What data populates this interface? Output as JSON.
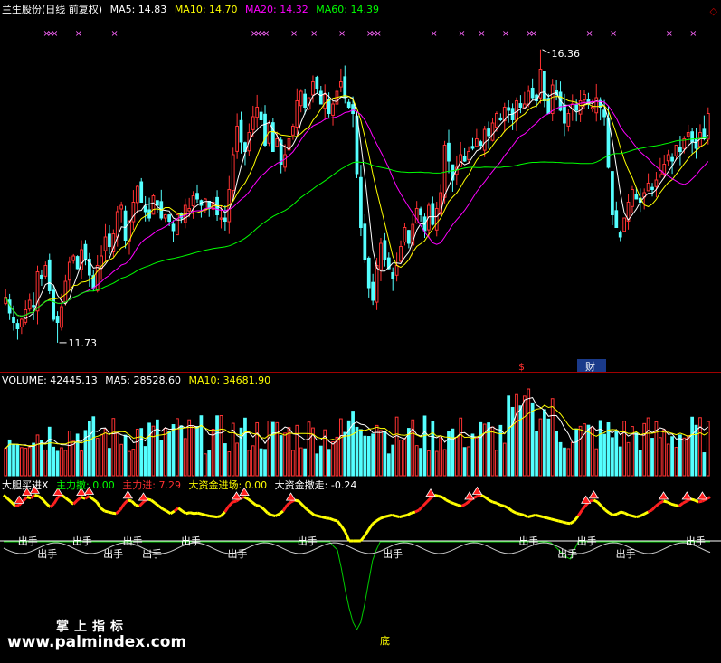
{
  "header1": {
    "stock": "兰生股份(日线 前复权)",
    "items": [
      {
        "label": "MA5: 14.83",
        "color": "#ffffff"
      },
      {
        "label": "MA10: 14.70",
        "color": "#ffff00"
      },
      {
        "label": "MA20: 14.32",
        "color": "#ff00ff"
      },
      {
        "label": "MA60: 14.39",
        "color": "#00ff00"
      }
    ]
  },
  "header2": {
    "items": [
      {
        "label": "VOLUME: 42445.13",
        "color": "#ffffff"
      },
      {
        "label": "MA5: 28528.60",
        "color": "#ffffff"
      },
      {
        "label": "MA10: 34681.90",
        "color": "#ffff00"
      }
    ]
  },
  "header3": {
    "items": [
      {
        "label": "大胆买进X",
        "color": "#ffffff"
      },
      {
        "label": "主力撤: 0.00",
        "color": "#00ff00"
      },
      {
        "label": "主力进: 7.29",
        "color": "#ff3030"
      },
      {
        "label": "大资金进场: 0.00",
        "color": "#ffff00"
      },
      {
        "label": "大资金撤走: -0.24",
        "color": "#ffffff"
      }
    ]
  },
  "annotations": {
    "high": "16.36",
    "low": "11.73",
    "s_marker": "$",
    "cai_marker": "财",
    "sell_label": "出手",
    "bottom_label": "底"
  },
  "watermark": {
    "line1": "掌上指标",
    "line2": "www.palmindex.com"
  },
  "colors": {
    "up": "#ff3232",
    "down": "#54ffff",
    "ma5": "#ffffff",
    "ma10": "#ffff00",
    "ma20": "#ff00ff",
    "ma60": "#00ff00",
    "signal_x": "#ff66ff"
  },
  "chart_data": {
    "type": "candlestick",
    "title": "兰生股份(日线 前复权)",
    "price_high_label": 16.36,
    "price_low_label": 11.73,
    "ma_last": {
      "MA5": 14.83,
      "MA10": 14.7,
      "MA20": 14.32,
      "MA60": 14.39
    },
    "volume_last": {
      "VOLUME": 42445.13,
      "MA5": 28528.6,
      "MA10": 34681.9
    },
    "indicator_last": {
      "主力撤": 0.0,
      "主力进": 7.29,
      "大资金进场": 0.0,
      "大资金撤走": -0.24
    },
    "closes": [
      12.45,
      12.2,
      12.05,
      11.95,
      12.1,
      12.25,
      12.4,
      12.3,
      12.85,
      12.75,
      12.95,
      12.55,
      12.1,
      12.05,
      12.3,
      12.7,
      13.0,
      13.1,
      12.9,
      13.2,
      13.05,
      12.8,
      12.6,
      12.95,
      13.1,
      13.4,
      13.25,
      13.45,
      13.8,
      13.9,
      13.35,
      13.65,
      13.95,
      14.2,
      13.95,
      13.8,
      13.7,
      14.05,
      13.9,
      13.7,
      13.75,
      13.65,
      13.5,
      13.75,
      13.7,
      13.9,
      13.85,
      14.05,
      14.0,
      13.9,
      14.0,
      13.85,
      13.95,
      13.75,
      13.7,
      13.65,
      14.15,
      14.7,
      15.15,
      14.9,
      14.75,
      15.05,
      15.3,
      15.45,
      15.25,
      14.85,
      15.2,
      14.75,
      14.95,
      14.55,
      14.7,
      14.95,
      15.15,
      15.55,
      15.7,
      15.45,
      15.6,
      15.85,
      15.75,
      15.5,
      15.65,
      15.35,
      15.5,
      15.7,
      15.85,
      15.6,
      15.45,
      15.35,
      14.4,
      13.55,
      13.05,
      12.6,
      12.4,
      12.95,
      13.3,
      13.05,
      12.9,
      12.75,
      12.95,
      13.25,
      13.55,
      13.3,
      13.6,
      13.85,
      13.75,
      13.5,
      13.9,
      13.6,
      13.85,
      14.1,
      14.85,
      14.6,
      14.3,
      14.5,
      14.7,
      14.6,
      14.75,
      14.8,
      14.95,
      14.85,
      15.1,
      15.0,
      15.2,
      15.35,
      15.25,
      15.45,
      15.4,
      15.25,
      15.55,
      15.45,
      15.5,
      15.7,
      15.6,
      15.55,
      16.05,
      15.55,
      15.35,
      15.8,
      15.65,
      15.4,
      15.2,
      15.35,
      15.5,
      15.4,
      15.55,
      15.65,
      15.5,
      15.45,
      15.6,
      15.45,
      15.3,
      14.5,
      13.75,
      13.55,
      13.4,
      13.7,
      13.95,
      14.15,
      14.0,
      13.95,
      14.1,
      14.25,
      14.15,
      14.3,
      14.45,
      14.55,
      14.7,
      14.6,
      14.85,
      14.75,
      14.95,
      15.05,
      14.9,
      14.8,
      15.05,
      14.95,
      15.35
    ],
    "rsi_like": [
      92,
      85,
      78,
      70,
      72,
      80,
      88,
      86,
      92,
      90,
      84,
      75,
      68,
      75,
      88,
      92,
      86,
      80,
      74,
      82,
      88,
      85,
      90,
      84,
      78,
      66,
      60,
      58,
      56,
      55,
      62,
      74,
      82,
      80,
      72,
      70,
      78,
      84,
      82,
      76,
      70,
      64,
      60,
      55,
      60,
      66,
      60,
      55,
      57,
      55,
      56,
      54,
      52,
      50,
      49,
      48,
      50,
      58,
      70,
      78,
      80,
      86,
      88,
      84,
      78,
      72,
      70,
      64,
      56,
      52,
      50,
      54,
      60,
      72,
      78,
      82,
      80,
      72,
      64,
      58,
      52,
      50,
      48,
      46,
      45,
      42,
      40,
      30,
      18,
      8,
      0,
      -4,
      0,
      10,
      22,
      34,
      40,
      45,
      48,
      50,
      52,
      50,
      48,
      50,
      52,
      56,
      58,
      62,
      70,
      78,
      86,
      92,
      90,
      88,
      82,
      78,
      75,
      72,
      70,
      74,
      80,
      86,
      90,
      92,
      88,
      82,
      78,
      76,
      72,
      70,
      66,
      60,
      56,
      54,
      52,
      48,
      50,
      52,
      50,
      48,
      46,
      44,
      42,
      40,
      38,
      36,
      35,
      40,
      50,
      62,
      72,
      80,
      82,
      78,
      70,
      62,
      56,
      52,
      54,
      58,
      56,
      52,
      50,
      48,
      50,
      54,
      58,
      62,
      70,
      76,
      80,
      78,
      74,
      72,
      70,
      76,
      80,
      84,
      82,
      78,
      80,
      84,
      88
    ]
  }
}
